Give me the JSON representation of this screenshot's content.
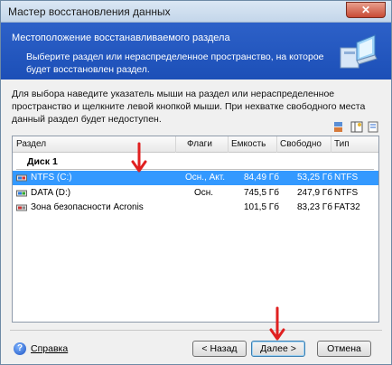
{
  "window": {
    "title": "Мастер восстановления данных",
    "close_label": "✕"
  },
  "header": {
    "title": "Местоположение восстанавливаемого раздела",
    "description": "Выберите раздел или нераспределенное пространство, на которое будет восстановлен раздел."
  },
  "instructions": "Для выбора наведите указатель мыши на раздел или нераспределенное пространство и щелкните левой кнопкой мыши. При нехватке свободного места данный раздел будет недоступен.",
  "table": {
    "columns": [
      "Раздел",
      "Флаги",
      "Емкость",
      "Свободно",
      "Тип"
    ],
    "group": "Диск 1",
    "rows": [
      {
        "name": "NTFS (C:)",
        "flags": "Осн., Акт.",
        "capacity": "84,49 Гб",
        "free": "53,25 Гб",
        "type": "NTFS",
        "selected": true
      },
      {
        "name": "DATA (D:)",
        "flags": "Осн.",
        "capacity": "745,5 Гб",
        "free": "247,9 Гб",
        "type": "NTFS",
        "selected": false
      },
      {
        "name": "Зона безопасности Acronis",
        "flags": "",
        "capacity": "101,5 Гб",
        "free": "83,23 Гб",
        "type": "FAT32",
        "selected": false
      }
    ]
  },
  "footer": {
    "help_label": "Справка",
    "back_label": "< Назад",
    "next_label": "Далее >",
    "cancel_label": "Отмена"
  },
  "colors": {
    "header_bg": "#2458c0",
    "selection": "#3399ff",
    "annotation_arrow": "#e02020"
  },
  "icons": [
    "computer-wizard-icon",
    "disk-icon",
    "partition-icon",
    "help-icon",
    "tool-icons",
    "red-arrow"
  ]
}
